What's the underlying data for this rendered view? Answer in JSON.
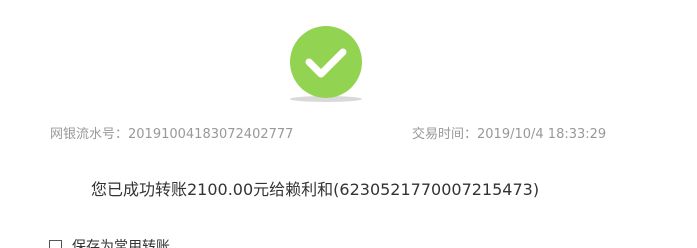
{
  "status": {
    "icon": "check-circle-icon",
    "color": "#92d351"
  },
  "meta": {
    "serial_label": "网银流水号：",
    "serial_value": "20191004183072402777",
    "time_label": "交易时间：",
    "time_value": "2019/10/4 18:33:29"
  },
  "message": "您已成功转账2100.00元给赖利和(6230521770007215473)",
  "save_option": {
    "label": "保存为常用转账",
    "checked": false
  }
}
